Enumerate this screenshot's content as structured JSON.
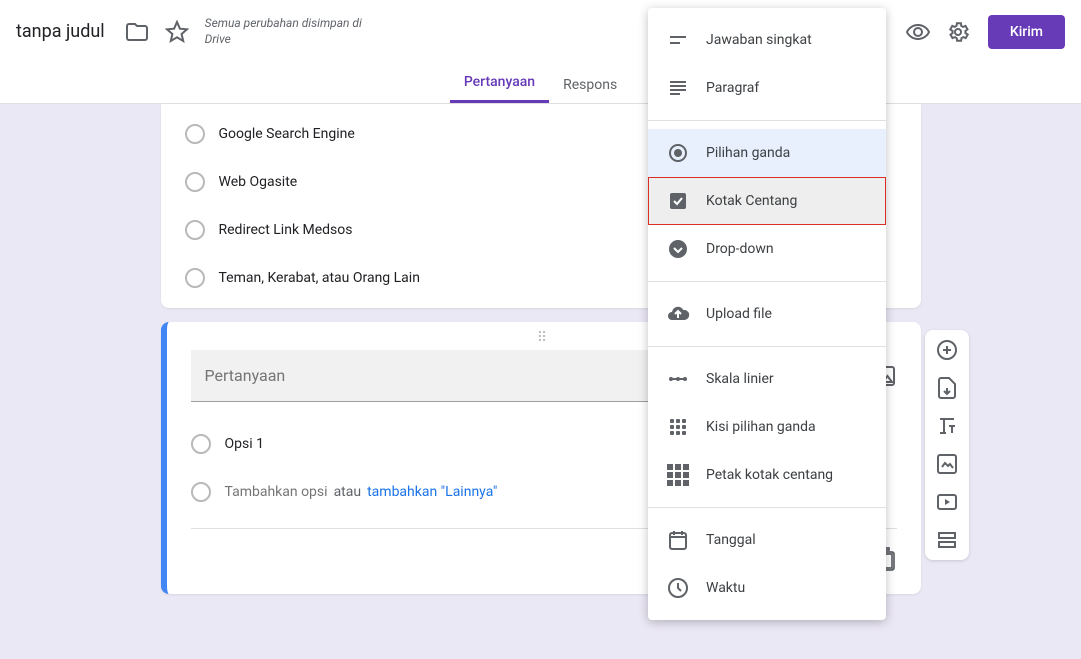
{
  "header": {
    "title": "tanpa judul",
    "save_message": "Semua perubahan disimpan di Drive",
    "send_label": "Kirim"
  },
  "tabs": {
    "questions": "Pertanyaan",
    "responses": "Respons"
  },
  "question1": {
    "options": [
      "Google Search Engine",
      "Web Ogasite",
      "Redirect Link Medsos",
      "Teman, Kerabat, atau Orang Lain"
    ]
  },
  "question2": {
    "placeholder": "Pertanyaan",
    "option1": "Opsi 1",
    "add_option": "Tambahkan opsi",
    "or": "atau",
    "add_other": "tambahkan \"Lainnya\""
  },
  "dropdown": {
    "short_answer": "Jawaban singkat",
    "paragraph": "Paragraf",
    "multiple_choice": "Pilihan ganda",
    "checkboxes": "Kotak Centang",
    "dropdown": "Drop-down",
    "file_upload": "Upload file",
    "linear_scale": "Skala linier",
    "mc_grid": "Kisi pilihan ganda",
    "cb_grid": "Petak kotak centang",
    "date": "Tanggal",
    "time": "Waktu"
  }
}
